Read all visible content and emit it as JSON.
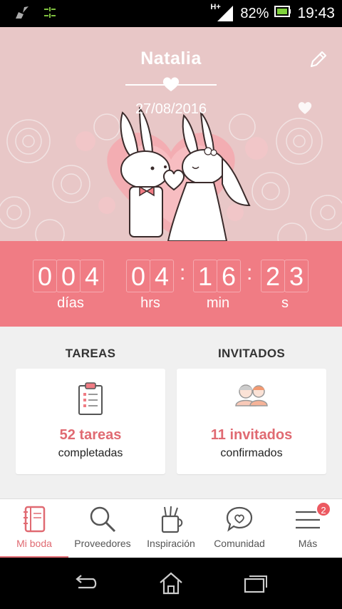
{
  "status_bar": {
    "network": "H+",
    "battery_percent": "82%",
    "time": "19:43"
  },
  "header": {
    "name": "Natalia",
    "date": "27/08/2016"
  },
  "countdown": {
    "days": [
      "0",
      "0",
      "4"
    ],
    "hours": [
      "0",
      "4"
    ],
    "minutes": [
      "1",
      "6"
    ],
    "seconds": [
      "2",
      "3"
    ],
    "labels": {
      "days": "días",
      "hours": "hrs",
      "minutes": "min",
      "seconds": "s"
    }
  },
  "sections": {
    "tasks": {
      "title": "TAREAS",
      "count": "52 tareas",
      "subtitle": "completadas"
    },
    "guests": {
      "title": "INVITADOS",
      "count": "11 invitados",
      "subtitle": "confirmados"
    }
  },
  "bottom_nav": {
    "items": [
      {
        "label": "Mi boda",
        "icon": "notebook-icon",
        "active": true
      },
      {
        "label": "Proveedores",
        "icon": "search-icon",
        "active": false
      },
      {
        "label": "Inspiración",
        "icon": "pencil-cup-icon",
        "active": false
      },
      {
        "label": "Comunidad",
        "icon": "heart-chat-icon",
        "active": false
      },
      {
        "label": "Más",
        "icon": "menu-icon",
        "active": false
      }
    ],
    "more_badge": "2"
  },
  "colors": {
    "accent": "#f07c84",
    "accent_text": "#e06a72",
    "header_bg": "#e8c7c7"
  }
}
